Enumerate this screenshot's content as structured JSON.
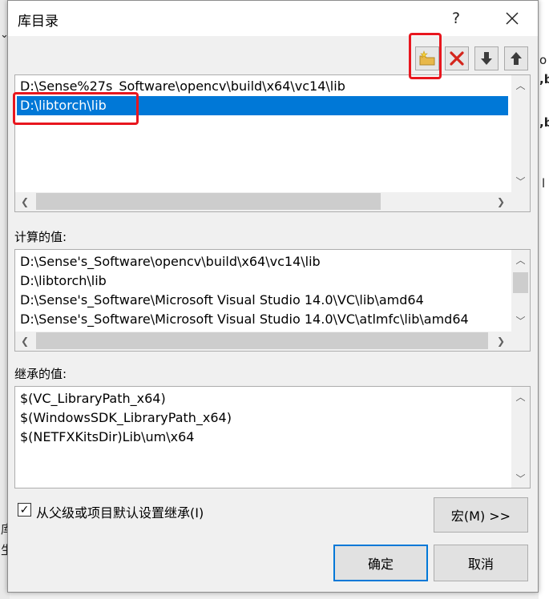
{
  "window": {
    "title": "库目录",
    "help_label": "?",
    "close_label": "✕"
  },
  "background": {
    "left_chevron": "⌄",
    "right_frags": [
      "o",
      ",b",
      ",b",
      "l"
    ],
    "left_frags": [
      "库",
      "生"
    ]
  },
  "toolbar": {
    "new_line_icon": "new-folder-icon",
    "delete_icon": "delete-x-icon",
    "move_down_icon": "arrow-down-icon",
    "move_up_icon": "arrow-up-icon"
  },
  "directories": {
    "items": [
      {
        "text": "D:\\Sense%27s_Software\\opencv\\build\\x64\\vc14\\lib",
        "selected": false
      },
      {
        "text": "D:\\libtorch\\lib",
        "selected": true
      }
    ]
  },
  "computed": {
    "label": "计算的值:",
    "items": [
      "D:\\Sense's_Software\\opencv\\build\\x64\\vc14\\lib",
      "D:\\libtorch\\lib",
      "D:\\Sense's_Software\\Microsoft Visual Studio 14.0\\VC\\lib\\amd64",
      "D:\\Sense's_Software\\Microsoft Visual Studio 14.0\\VC\\atlmfc\\lib\\amd64"
    ]
  },
  "inherited": {
    "label": "继承的值:",
    "items": [
      "$(VC_LibraryPath_x64)",
      "$(WindowsSDK_LibraryPath_x64)",
      "$(NETFXKitsDir)Lib\\um\\x64"
    ]
  },
  "inherit_checkbox": {
    "label": "从父级或项目默认设置继承(I)",
    "checked": true
  },
  "buttons": {
    "macro": "宏(M) >>",
    "ok": "确定",
    "cancel": "取消"
  },
  "colors": {
    "selection": "#0078d7",
    "highlight": "#e8161e"
  }
}
